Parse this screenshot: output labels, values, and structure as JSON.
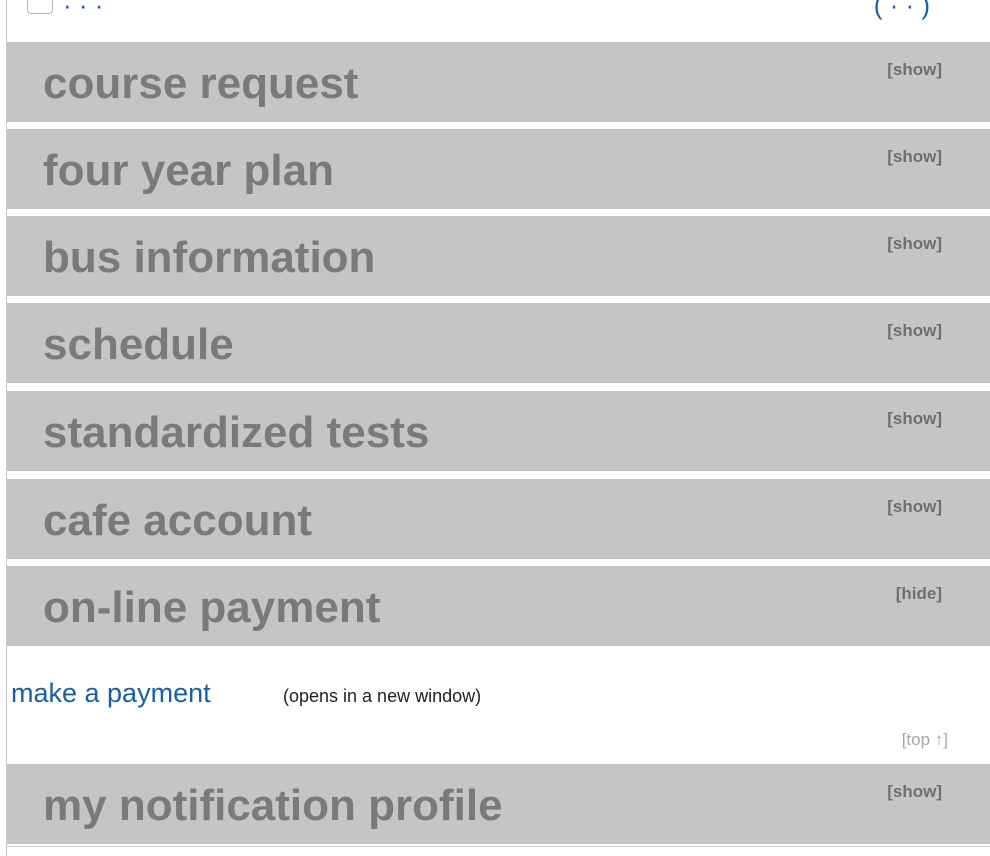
{
  "top_row": {
    "link_left": "·  ·  ·",
    "link_right": "(  ·  ·  )"
  },
  "sections": [
    {
      "title": "course request",
      "toggle": "[show]"
    },
    {
      "title": "four year plan",
      "toggle": "[show]"
    },
    {
      "title": "bus information",
      "toggle": "[show]"
    },
    {
      "title": "schedule",
      "toggle": "[show]"
    },
    {
      "title": "standardized tests",
      "toggle": "[show]"
    },
    {
      "title": "cafe account",
      "toggle": "[show]"
    },
    {
      "title": "on-line payment",
      "toggle": "[hide]"
    },
    {
      "title": "my notification profile",
      "toggle": "[show]"
    }
  ],
  "online_payment": {
    "link_label": "make a payment",
    "link_note": "(opens in a new window)",
    "top_link": "[top ↑]"
  },
  "colors": {
    "section_bg": "#c5c5c5",
    "section_text": "#7a7a7a",
    "link": "#1a5ea8"
  }
}
